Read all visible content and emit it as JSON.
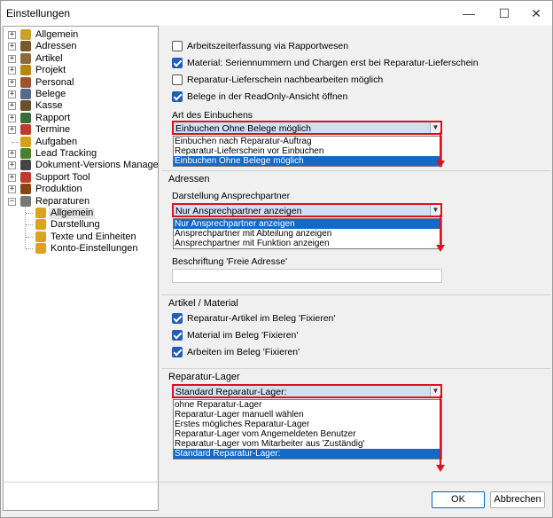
{
  "window": {
    "title": "Einstellungen",
    "minimize": "—",
    "maximize": "☐",
    "close": "✕"
  },
  "tree": {
    "items": [
      {
        "label": "Allgemein",
        "icon": "pencil-icon",
        "expander": "+"
      },
      {
        "label": "Adressen",
        "icon": "address-book-icon",
        "expander": "+"
      },
      {
        "label": "Artikel",
        "icon": "article-icon",
        "expander": "+"
      },
      {
        "label": "Projekt",
        "icon": "project-icon",
        "expander": "+"
      },
      {
        "label": "Personal",
        "icon": "person-icon",
        "expander": "+"
      },
      {
        "label": "Belege",
        "icon": "document-icon",
        "expander": "+"
      },
      {
        "label": "Kasse",
        "icon": "cash-register-icon",
        "expander": "+"
      },
      {
        "label": "Rapport",
        "icon": "report-icon",
        "expander": "+"
      },
      {
        "label": "Termine",
        "icon": "calendar-icon",
        "expander": "+"
      },
      {
        "label": "Aufgaben",
        "icon": "task-icon",
        "expander": ""
      },
      {
        "label": "Lead Tracking",
        "icon": "lead-icon",
        "expander": "+"
      },
      {
        "label": "Dokument-Versions Manager",
        "icon": "document-version-icon",
        "expander": "+"
      },
      {
        "label": "Support Tool",
        "icon": "support-icon",
        "expander": "+"
      },
      {
        "label": "Produktion",
        "icon": "production-icon",
        "expander": "+"
      },
      {
        "label": "Reparaturen",
        "icon": "repair-icon",
        "expander": "−"
      }
    ],
    "children": [
      {
        "label": "Allgemein",
        "icon": "folder-settings-icon",
        "selected": true
      },
      {
        "label": "Darstellung",
        "icon": "folder-settings-icon",
        "selected": false
      },
      {
        "label": "Texte und Einheiten",
        "icon": "folder-settings-icon",
        "selected": false
      },
      {
        "label": "Konto-Einstellungen",
        "icon": "folder-settings-icon",
        "selected": false
      }
    ]
  },
  "general": {
    "checkboxes": [
      {
        "label": "Arbeitszeiterfassung via Rapportwesen",
        "checked": false
      },
      {
        "label": "Material: Seriennummern und Chargen erst bei Reparatur-Lieferschein",
        "checked": true
      },
      {
        "label": "Reparatur-Lieferschein nachbearbeiten möglich",
        "checked": false
      },
      {
        "label": "Belege in der ReadOnly-Ansicht öffnen",
        "checked": true
      }
    ],
    "booking_label": "Art des Einbuchens",
    "booking_value": "Einbuchen Ohne Belege möglich",
    "booking_options": [
      "Einbuchen nach Reparatur-Auftrag",
      "Reparatur-Lieferschein vor Einbuchen",
      "Einbuchen Ohne Belege möglich"
    ],
    "booking_selected_index": 2
  },
  "addresses": {
    "title": "Adressen",
    "contact_label": "Darstellung Ansprechpartner",
    "contact_value": "Nur Ansprechpartner anzeigen",
    "contact_options": [
      "Nur Ansprechpartner anzeigen",
      "Ansprechpartner mit Abteilung anzeigen",
      "Ansprechpartner mit Funktion anzeigen"
    ],
    "contact_selected_index": 0,
    "free_address_label": "Beschriftung 'Freie Adresse'",
    "free_address_value": ""
  },
  "material": {
    "title": "Artikel / Material",
    "checkboxes": [
      {
        "label": "Reparatur-Artikel im Beleg 'Fixieren'",
        "checked": true
      },
      {
        "label": "Material im Beleg 'Fixieren'",
        "checked": true
      },
      {
        "label": "Arbeiten im Beleg 'Fixieren'",
        "checked": true
      }
    ]
  },
  "storage": {
    "title": "Reparatur-Lager",
    "value": "Standard Reparatur-Lager:",
    "options": [
      "ohne Reparatur-Lager",
      "Reparatur-Lager manuell wählen",
      "Erstes mögliches Reparatur-Lager",
      "Reparatur-Lager vom Angemeldeten Benutzer",
      "Reparatur-Lager vom Mitarbeiter aus 'Zuständig'",
      "Standard Reparatur-Lager:"
    ],
    "selected_index": 5
  },
  "buttons": {
    "ok": "OK",
    "cancel": "Abbrechen"
  },
  "colors": {
    "accent": "#1469c7",
    "highlight_border": "#e0101c",
    "combo_fill": "#cfe0f4"
  }
}
